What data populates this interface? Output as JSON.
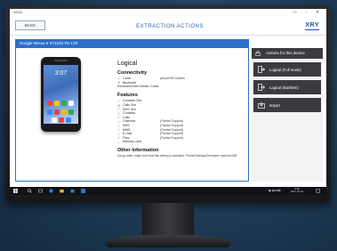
{
  "app": {
    "brand": "MSAB",
    "title": "EXTRACTION ACTIONS",
    "back_label": "BACK",
    "logo": "XRY",
    "window_controls": "— ▫ ✕"
  },
  "device": {
    "header": "Google Nexus 6 XT1103 TD-LTE",
    "phone_clock": "3:07"
  },
  "logical": {
    "title": "Logical",
    "connectivity_title": "Connectivity",
    "connectivity": [
      {
        "status": "ok",
        "label": "Cable",
        "note": "phone/SB Cables"
      },
      {
        "status": "no",
        "label": "Bluetooth",
        "note": ""
      }
    ],
    "recommended": "Recommended Media: Cable",
    "features_title": "Features",
    "features": [
      {
        "status": "ok",
        "label": "Contacts Sim",
        "note": ""
      },
      {
        "status": "no",
        "label": "Calls Sim",
        "note": ""
      },
      {
        "status": "ok",
        "label": "SMS Sim",
        "note": ""
      },
      {
        "status": "ok",
        "label": "Contacts",
        "note": ""
      },
      {
        "status": "ok",
        "label": "Calls",
        "note": ""
      },
      {
        "status": "ok",
        "label": "Calendar",
        "note": "(Partial Support)"
      },
      {
        "status": "ok",
        "label": "SMS",
        "note": "(Partial Support)"
      },
      {
        "status": "ok",
        "label": "MMS",
        "note": "(Partial Support)"
      },
      {
        "status": "ok",
        "label": "E-mail",
        "note": "(Partial Support)"
      },
      {
        "status": "ok",
        "label": "Files",
        "note": "(Partial Support)"
      },
      {
        "status": "dash",
        "label": "Memory card",
        "note": ""
      }
    ],
    "other_title": "Other Information",
    "other_text": "Using cable, make sure that this setting is activated: Phone/Settings/Developer options/USB"
  },
  "actions": {
    "header": "Actions for this device",
    "buttons": [
      {
        "label": "Logical (Full mode)"
      },
      {
        "label": "Logical (Bar/item)"
      },
      {
        "label": "Import"
      }
    ]
  },
  "taskbar": {
    "tray_time": "9:00",
    "tray_date": "2017-01-01"
  },
  "colors": {
    "accent": "#2e6fc9",
    "dark_button": "#3a3b3e",
    "check": "#2aa33a",
    "cross": "#d23a3a"
  }
}
